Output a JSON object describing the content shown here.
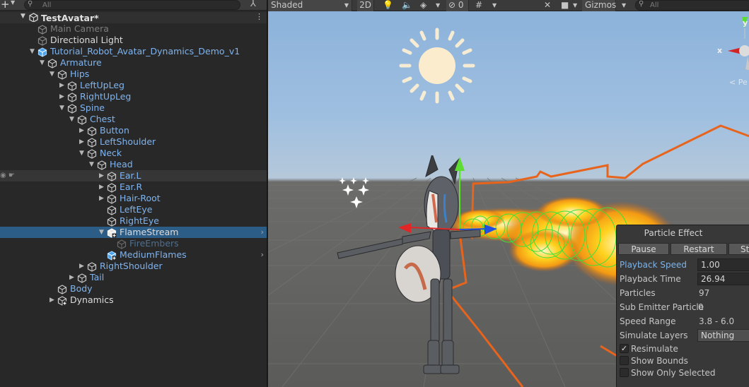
{
  "hierarchy": {
    "search_placeholder": "All",
    "scene_name": "TestAvatar*",
    "rows": [
      {
        "label": "Main Camera",
        "color": "grey",
        "indent": 0,
        "arrow": "",
        "icon": "grey"
      },
      {
        "label": "Directional Light",
        "color": "white",
        "indent": 0,
        "arrow": "",
        "icon": "grey"
      },
      {
        "label": "Tutorial_Robot_Avatar_Dynamics_Demo_v1",
        "color": "blue",
        "indent": 0,
        "arrow": "open",
        "icon": "blue"
      },
      {
        "label": "Armature",
        "color": "blue",
        "indent": 1,
        "arrow": "open",
        "icon": "outline"
      },
      {
        "label": "Hips",
        "color": "blue",
        "indent": 2,
        "arrow": "open",
        "icon": "outline"
      },
      {
        "label": "LeftUpLeg",
        "color": "blue",
        "indent": 3,
        "arrow": "closed",
        "icon": "outline"
      },
      {
        "label": "RightUpLeg",
        "color": "blue",
        "indent": 3,
        "arrow": "closed",
        "icon": "outline"
      },
      {
        "label": "Spine",
        "color": "blue",
        "indent": 3,
        "arrow": "open",
        "icon": "outline"
      },
      {
        "label": "Chest",
        "color": "blue",
        "indent": 4,
        "arrow": "open",
        "icon": "outline"
      },
      {
        "label": "Button",
        "color": "blue",
        "indent": 5,
        "arrow": "closed",
        "icon": "outline"
      },
      {
        "label": "LeftShoulder",
        "color": "blue",
        "indent": 5,
        "arrow": "closed",
        "icon": "outline"
      },
      {
        "label": "Neck",
        "color": "blue",
        "indent": 5,
        "arrow": "open",
        "icon": "outline"
      },
      {
        "label": "Head",
        "color": "blue",
        "indent": 6,
        "arrow": "open",
        "icon": "outline"
      },
      {
        "label": "Ear.L",
        "color": "blue",
        "indent": 7,
        "arrow": "closed",
        "icon": "outline",
        "state": "hover"
      },
      {
        "label": "Ear.R",
        "color": "blue",
        "indent": 7,
        "arrow": "closed",
        "icon": "outline"
      },
      {
        "label": "Hair-Root",
        "color": "blue",
        "indent": 7,
        "arrow": "closed",
        "icon": "outline"
      },
      {
        "label": "LeftEye",
        "color": "blue",
        "indent": 7,
        "arrow": "",
        "icon": "outline"
      },
      {
        "label": "RightEye",
        "color": "blue",
        "indent": 7,
        "arrow": "",
        "icon": "outline"
      },
      {
        "label": "FlameStream",
        "color": "white",
        "indent": 7,
        "arrow": "open",
        "icon": "white-plus",
        "state": "selected"
      },
      {
        "label": "FireEmbers",
        "color": "dim",
        "indent": 8,
        "arrow": "",
        "icon": "dim"
      },
      {
        "label": "MediumFlames",
        "color": "blue",
        "indent": 7,
        "arrow": "",
        "icon": "blue-plus",
        "chevron": true
      },
      {
        "label": "RightShoulder",
        "color": "blue",
        "indent": 5,
        "arrow": "closed",
        "icon": "outline"
      },
      {
        "label": "Tail",
        "color": "blue",
        "indent": 4,
        "arrow": "closed",
        "icon": "outline"
      },
      {
        "label": "Body",
        "color": "blue",
        "indent": 2,
        "arrow": "",
        "icon": "outline"
      },
      {
        "label": "Dynamics",
        "color": "white",
        "indent": 2,
        "arrow": "closed",
        "icon": "outline-plus"
      }
    ]
  },
  "scene_toolbar": {
    "shading": "Shaded",
    "mode_2d": "2D",
    "hidden_count": "0",
    "gizmos": "Gizmos",
    "search_placeholder": "All"
  },
  "orientation_gizmo": {
    "x_label": "x",
    "y_label": "y",
    "projection": "< Pe"
  },
  "particle_effect": {
    "title": "Particle Effect",
    "buttons": [
      "Pause",
      "Restart",
      "St"
    ],
    "playback_speed_label": "Playback Speed",
    "playback_speed": "1.00",
    "playback_time_label": "Playback Time",
    "playback_time": "26.94",
    "particles_label": "Particles",
    "particles": "97",
    "sub_emitter_label": "Sub Emitter Particle",
    "sub_emitter": "0",
    "speed_range_label": "Speed Range",
    "speed_range": "3.8 - 6.0",
    "simulate_layers_label": "Simulate Layers",
    "simulate_layers": "Nothing",
    "resimulate_label": "Resimulate",
    "resimulate": true,
    "show_bounds_label": "Show Bounds",
    "show_bounds": false,
    "show_only_selected_label": "Show Only Selected",
    "show_only_selected": false
  },
  "colors": {
    "selection": "#2c5d87",
    "link_blue": "#7fb4ef",
    "bounds_orange": "#e8641c",
    "collider_green": "#3ee03a"
  }
}
